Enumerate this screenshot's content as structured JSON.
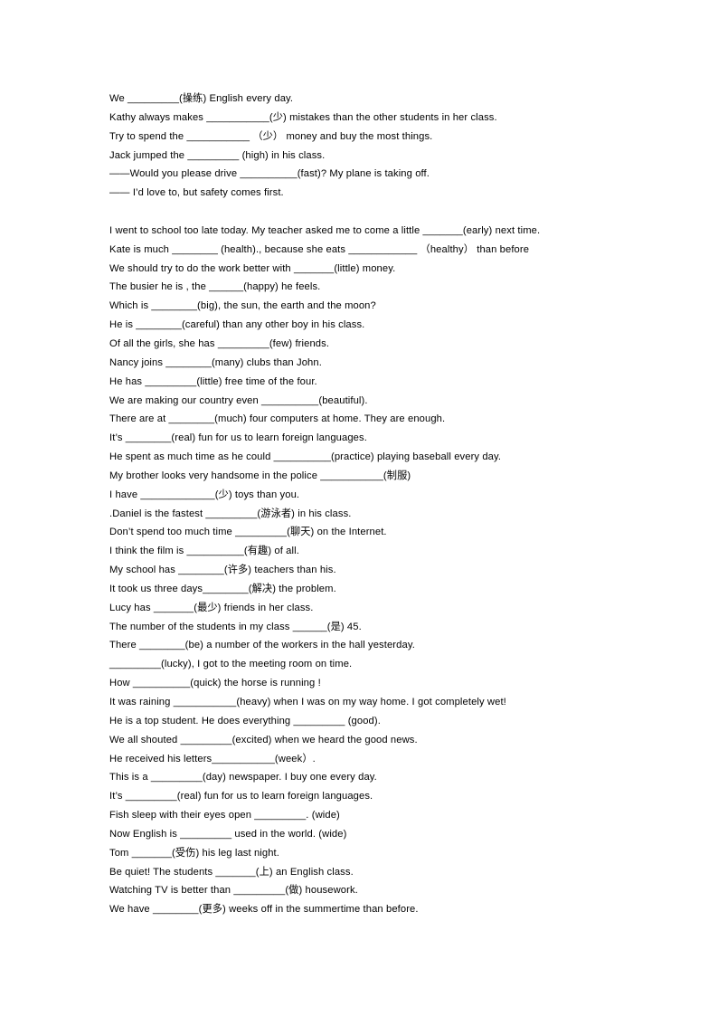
{
  "document": {
    "type": "grammar-fill-in-the-blank-worksheet",
    "page_background": "#ffffff",
    "text_color": "#000000",
    "blocks": [
      {
        "id": "block-1",
        "lines": [
          "We _________(操练) English every day.",
          "Kathy always makes ___________(少) mistakes than the other students in her class.",
          "Try to spend the ___________ （少） money and buy the most things.",
          "Jack jumped the _________ (high) in his class.",
          "——Would you please drive __________(fast)? My plane is taking off.",
          "—— I’d love to, but safety comes first."
        ]
      },
      {
        "id": "block-spacer",
        "lines": [
          ""
        ]
      },
      {
        "id": "block-2",
        "lines": [
          "I went to school too late today. My teacher asked me to come a little _______(early) next time.",
          "Kate is much ________ (health)., because she eats ____________ （healthy） than before",
          "We should try to do the work better with _______(little) money.",
          "The busier he is , the ______(happy) he feels.",
          "Which is ________(big), the sun, the earth and the moon?",
          "He is ________(careful) than any other boy in his class.",
          "Of all the girls, she has _________(few) friends.",
          "Nancy joins ________(many) clubs than John.",
          "He has _________(little) free time of the four.",
          "We are making our country even __________(beautiful).",
          "There are at ________(much) four computers at home. They are enough.",
          "It’s ________(real) fun for us to learn foreign languages.",
          "He spent as much time as he could __________(practice) playing baseball every day.",
          "My brother looks very handsome in the police ___________(制服)",
          "I have _____________(少) toys than you.",
          ".Daniel is the fastest _________(游泳者) in his class.",
          "Don’t spend too much time _________(聊天) on the Internet.",
          "I think the film is __________(有趣) of all.",
          "My school has ________(许多) teachers than his.",
          "It took us three days________(解决) the problem.",
          "Lucy has _______(最少) friends in her class.",
          "The number of the students in my class ______(是) 45.",
          "There ________(be) a number of the workers in the hall yesterday.",
          "_________(lucky), I got to the meeting room on time.",
          "How __________(quick) the horse is running !",
          "It was raining ___________(heavy) when I was on my way home. I got completely wet!",
          "He is a top student. He does everything _________ (good).",
          "We all shouted _________(excited) when we heard the good news.",
          "He received his letters___________(week）.",
          "This is a _________(day) newspaper. I buy one every day.",
          "It’s _________(real) fun for us to learn foreign languages.",
          "Fish sleep with their eyes open _________. (wide)",
          "Now English is _________ used in the world. (wide)",
          "Tom _______(受伤) his leg last night.",
          "Be quiet! The students _______(上) an English class.",
          "Watching TV is better than _________(做) housework.",
          "We have ________(更多) weeks off in the summertime than before."
        ]
      }
    ]
  }
}
